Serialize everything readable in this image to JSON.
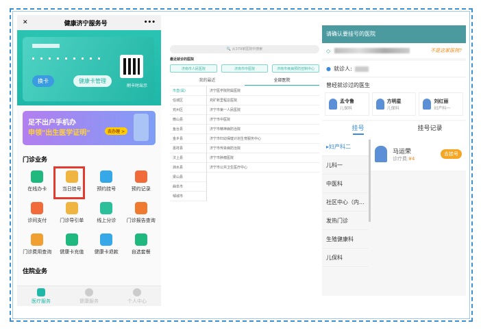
{
  "left": {
    "title": "健康济宁服务号",
    "close": "✕",
    "more": "•••",
    "card": {
      "switch_label": "换卡",
      "manage_label": "健康卡管理",
      "qr_label": "刷卡时出示"
    },
    "banner": {
      "line1": "足不出户手机办",
      "line2": "申领\"出生医学证明\"",
      "cta": "去办理 >"
    },
    "section1": "门诊业务",
    "items": [
      {
        "label": "在线办卡",
        "color": "#1fb87f"
      },
      {
        "label": "当日挂号",
        "color": "#f0b440"
      },
      {
        "label": "预约挂号",
        "color": "#36a8e8"
      },
      {
        "label": "预约记录",
        "color": "#f06a3a"
      },
      {
        "label": "诊间支付",
        "color": "#f06a3a"
      },
      {
        "label": "门诊导引单",
        "color": "#f0b440"
      },
      {
        "label": "线上分诊",
        "color": "#2bbf9a"
      },
      {
        "label": "门诊报告查询",
        "color": "#f07a30"
      },
      {
        "label": "门诊费用查询",
        "color": "#f0a030"
      },
      {
        "label": "健康卡充值",
        "color": "#1fb87f"
      },
      {
        "label": "健康卡退款",
        "color": "#36a8e8"
      },
      {
        "label": "自选套餐",
        "color": "#1fb87f"
      }
    ],
    "section2": "住院业务",
    "tabs": [
      "医疗服务",
      "健康服务",
      "个人中心"
    ]
  },
  "middle": {
    "search_placeholder": "从379家医院中搜索",
    "recent_label": "最近就诊的医院",
    "quick": [
      "济南市人民医院",
      "济南市中医院",
      "济南市疾病预防控制中心"
    ],
    "tabs": [
      "我的最近",
      "全部医院"
    ],
    "districts": [
      "市直(属)",
      "任城区",
      "兖州区",
      "微山县",
      "鱼台县",
      "金乡县",
      "嘉祥县",
      "汶上县",
      "泗水县",
      "梁山县",
      "曲阜市",
      "邹城市"
    ],
    "hospitals": [
      "济宁医学院附属医院",
      "兖矿新里程总医院",
      "济宁市第一人民医院",
      "济宁市中医院",
      "济宁市精神病防治院",
      "济宁市妇幼保健计划生育服务中心",
      "济宁市传染病防治院",
      "济宁市肿瘤医院",
      "济宁市公共卫生医疗中心"
    ]
  },
  "right": {
    "header": "请确认要挂号的医院",
    "not_this": "不是这家医院?",
    "patient_label": "就诊人:",
    "visited_title": "曾经就诊过的医生",
    "doctors": [
      {
        "name": "孟令鲁",
        "dept": "儿保科"
      },
      {
        "name": "方明星",
        "dept": "儿保科"
      },
      {
        "name": "刘红丽",
        "dept": "妇产科一"
      }
    ],
    "tabs": [
      "挂号",
      "挂号记录"
    ],
    "departments": [
      "妇产科二",
      "儿科一",
      "中医科",
      "社区中心（内...",
      "发热门诊",
      "生殖健康科",
      "儿保科"
    ],
    "doctor": {
      "name": "马运荣",
      "fee_label": "诊疗费:",
      "fee": "¥4",
      "button": "去挂号"
    }
  }
}
